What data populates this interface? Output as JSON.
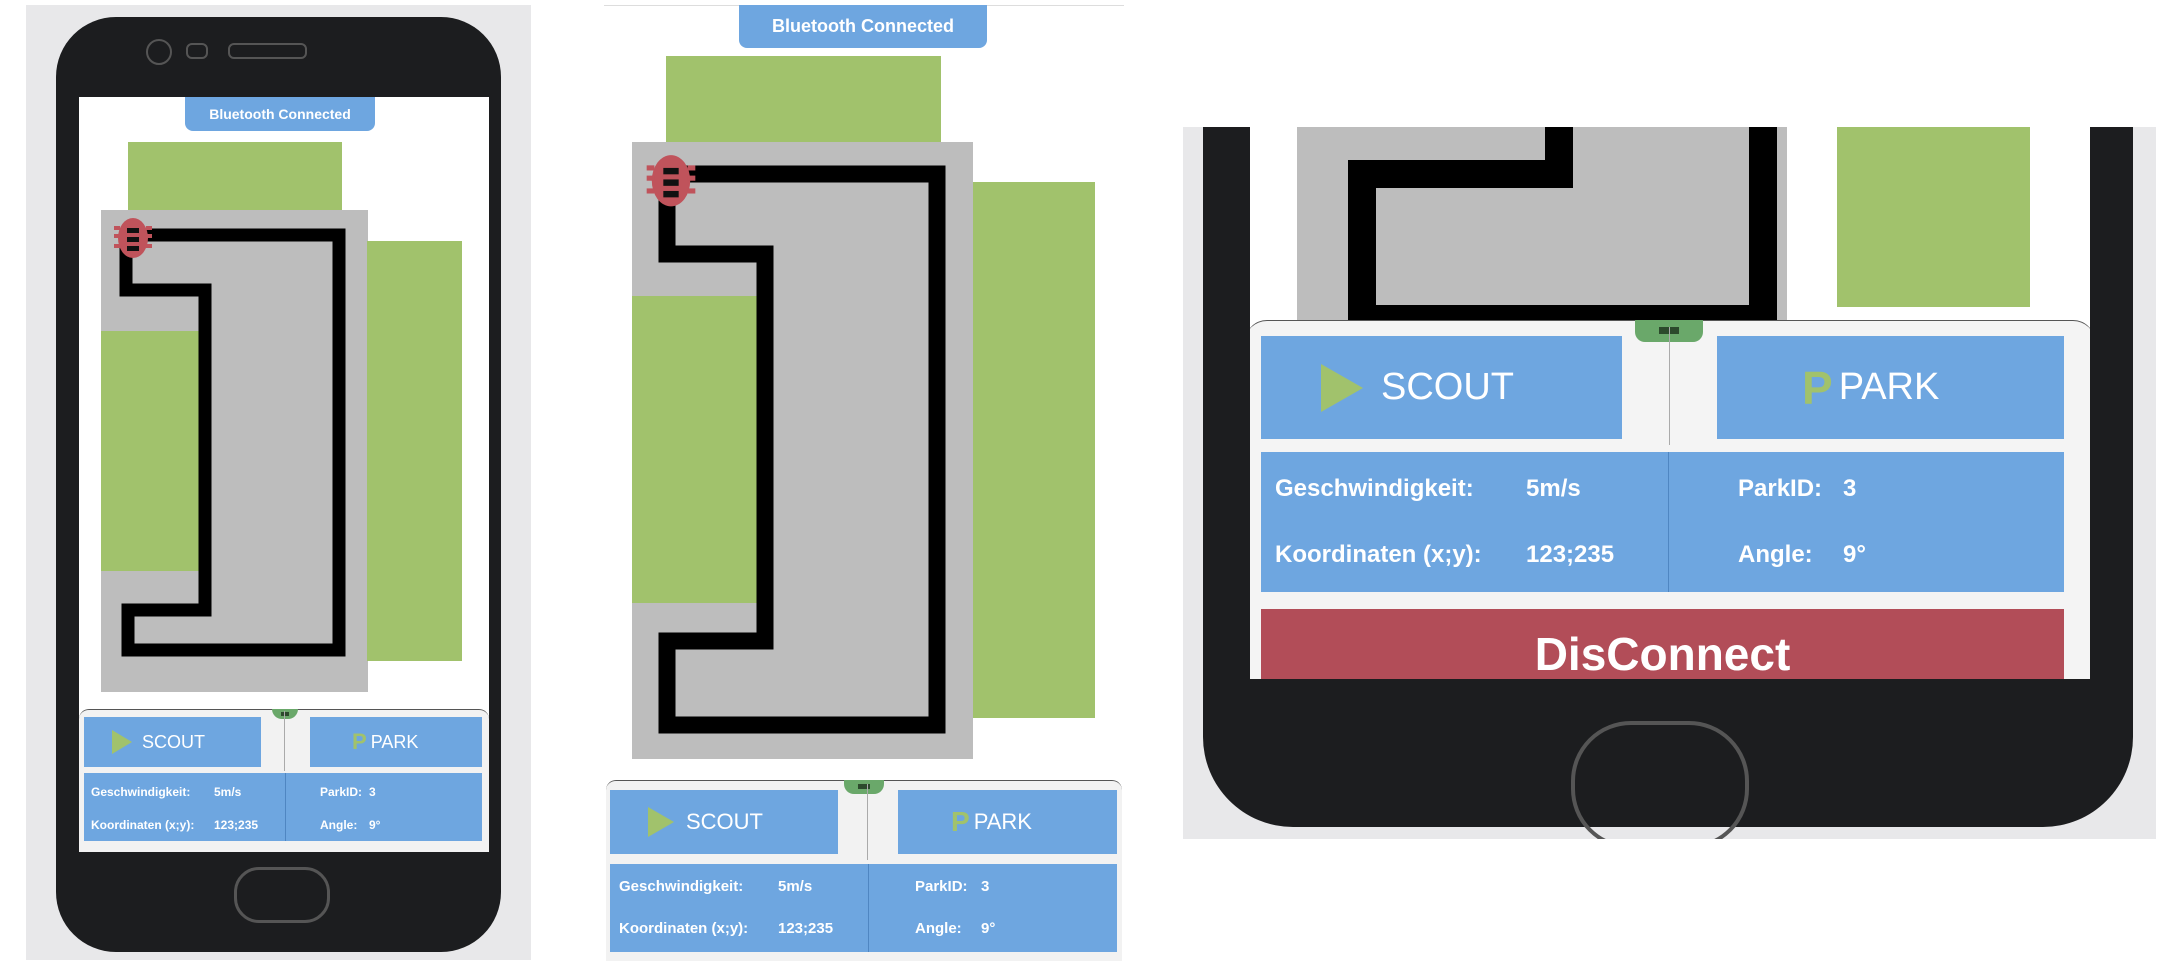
{
  "status": {
    "bluetooth_label": "Bluetooth Connected"
  },
  "controls": {
    "scout_label": "SCOUT",
    "park_label": "PARK",
    "park_icon": "P",
    "disconnect_label": "DisConnect"
  },
  "telemetry": {
    "speed_label": "Geschwindigkeit:",
    "speed_value": "5m/s",
    "coords_label": "Koordinaten (x;y):",
    "coords_value": "123;235",
    "parkid_label": "ParkID:",
    "parkid_value": "3",
    "angle_label": "Angle:",
    "angle_value": "9°"
  },
  "icons": {
    "scout": "play-icon",
    "park": "parking-icon",
    "car": "car-icon",
    "handle": "drawer-handle-icon"
  },
  "colors": {
    "accent": "#6ea6e0",
    "parking_space": "#a1c26c",
    "lot": "#bdbdbd",
    "danger": "#b24d58",
    "car": "#c0535b"
  }
}
